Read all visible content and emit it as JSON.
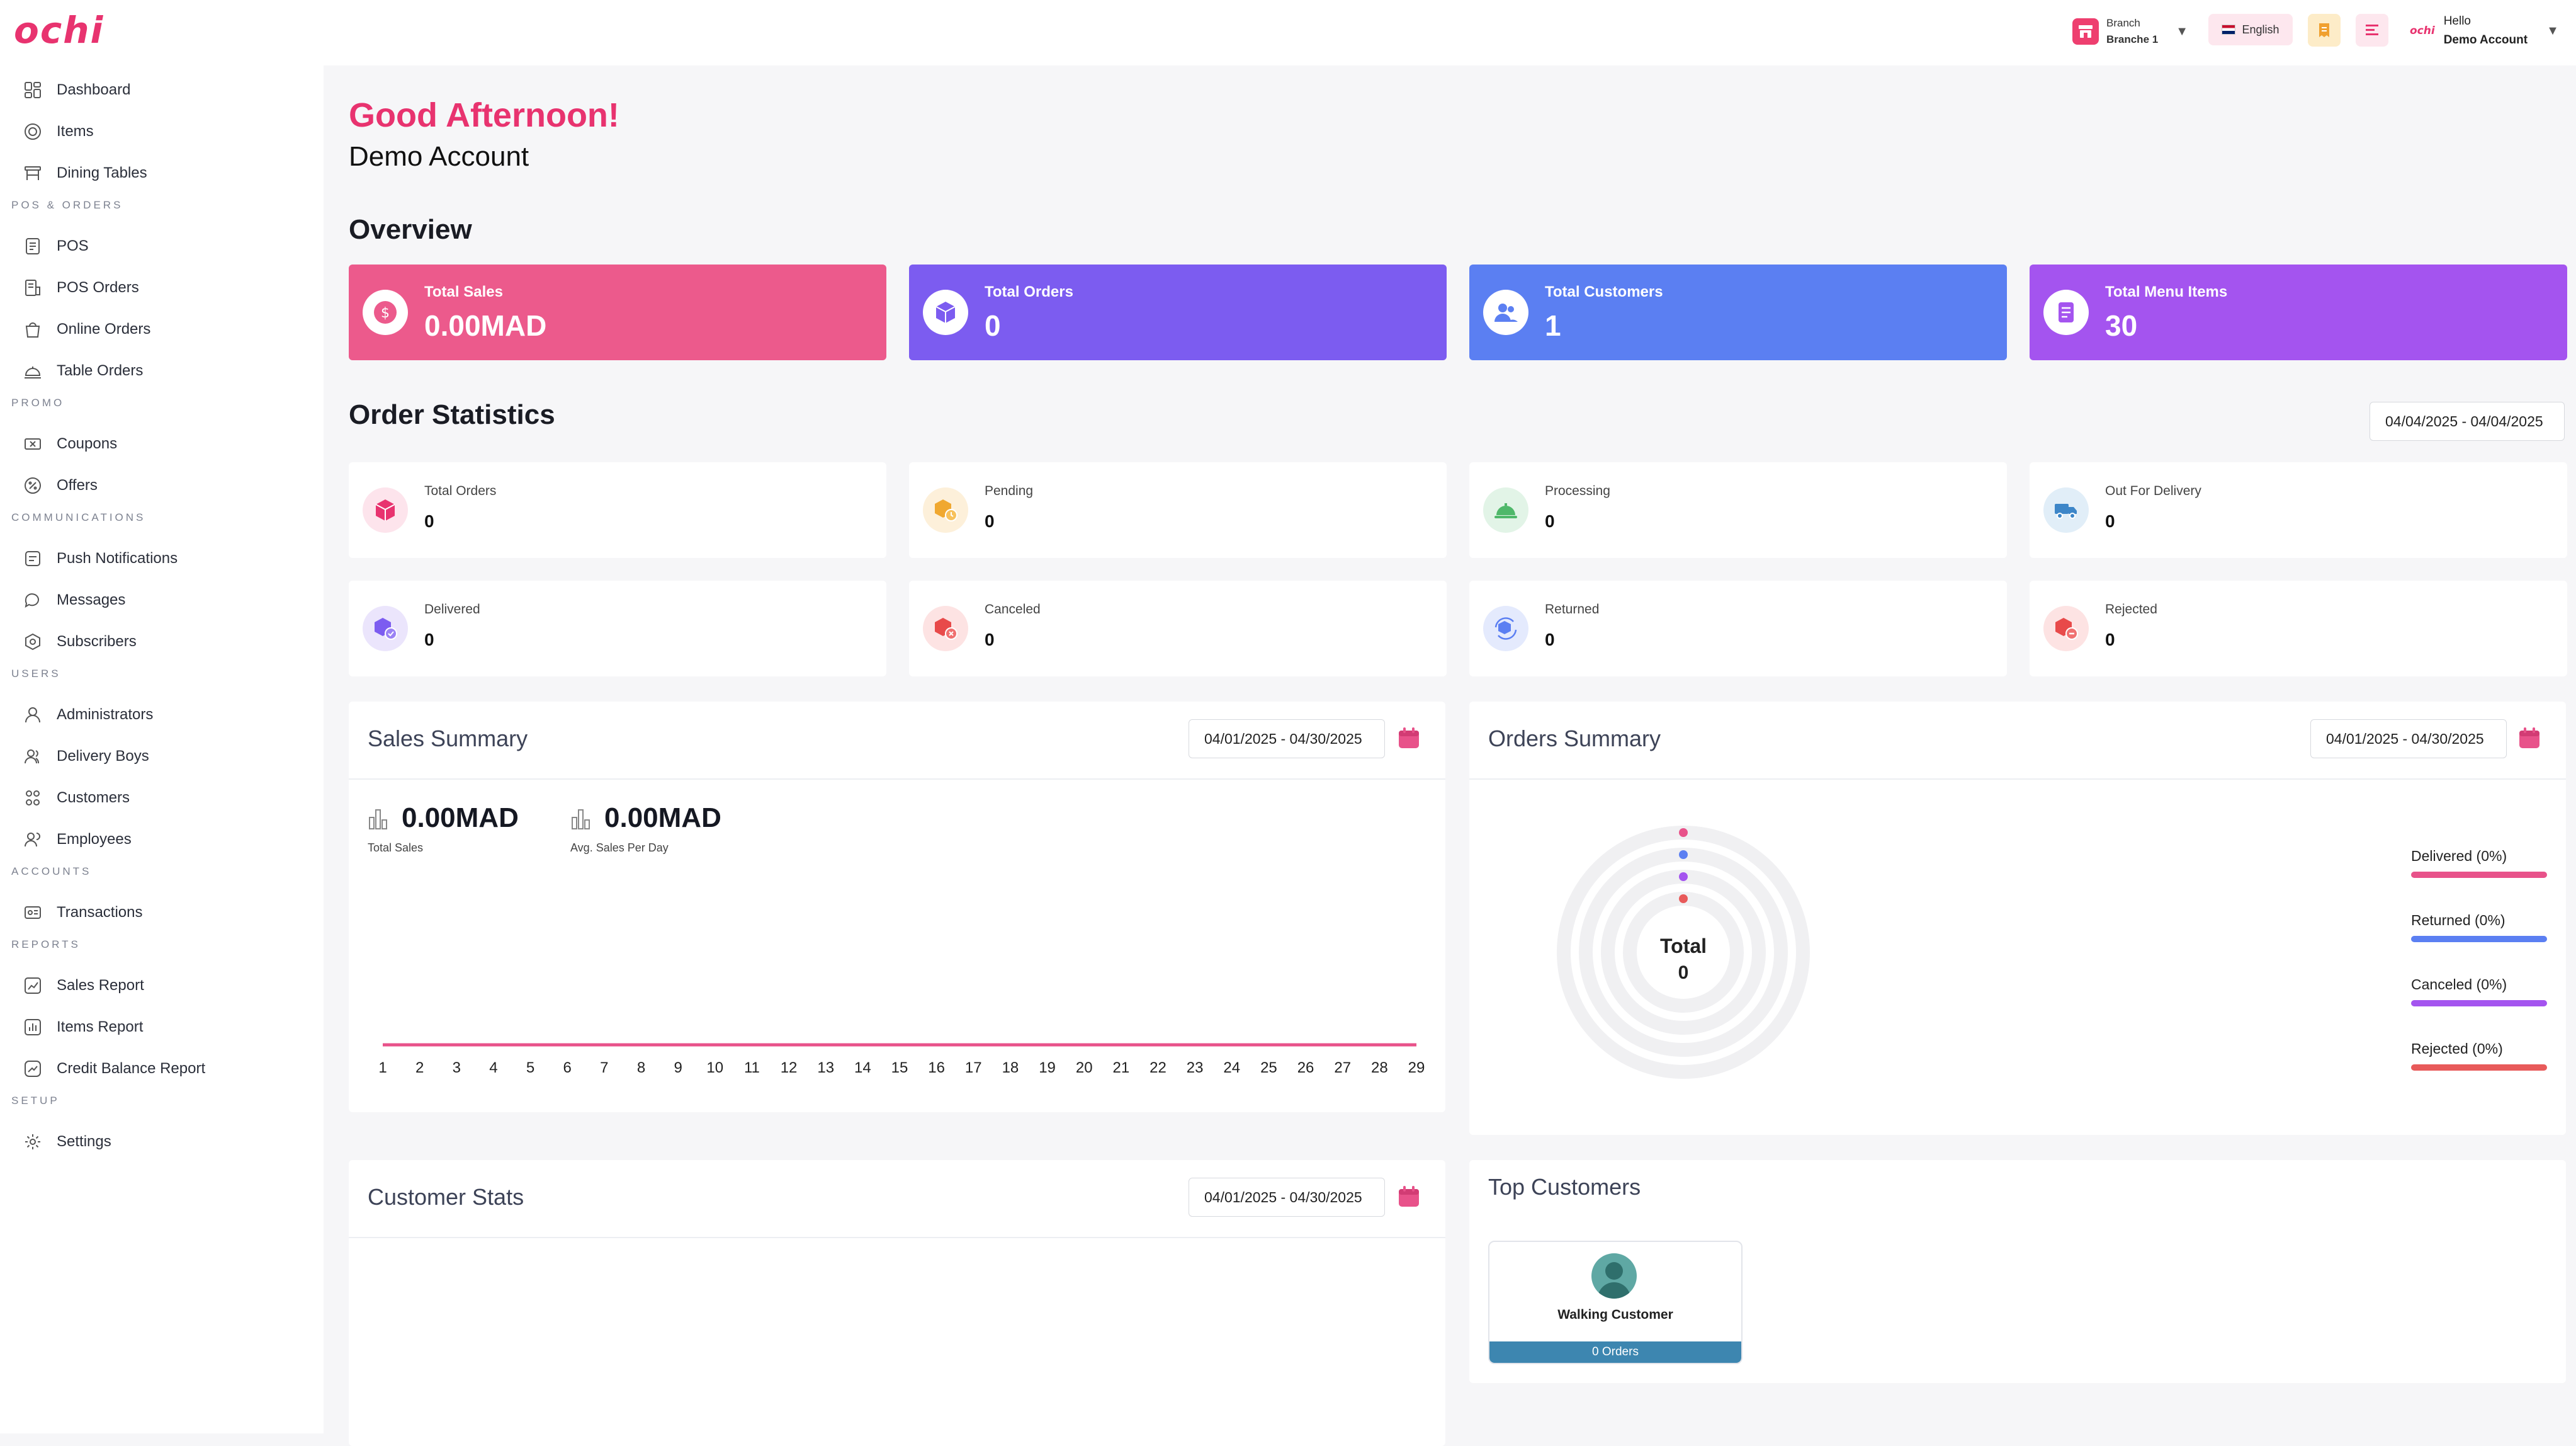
{
  "app": {
    "logo": "ochi"
  },
  "topbar": {
    "branch_label": "Branch",
    "branch_name": "Branche 1",
    "language": "English",
    "user_greeting": "Hello",
    "user_name": "Demo Account",
    "user_avatar_text": "ochi"
  },
  "sidebar": {
    "items": [
      {
        "label": "Dashboard",
        "icon": "dashboard-icon"
      },
      {
        "label": "Items",
        "icon": "items-icon"
      },
      {
        "label": "Dining Tables",
        "icon": "dining-table-icon"
      },
      {
        "label": "POS",
        "icon": "pos-icon"
      },
      {
        "label": "POS Orders",
        "icon": "pos-orders-icon"
      },
      {
        "label": "Online Orders",
        "icon": "bag-icon"
      },
      {
        "label": "Table Orders",
        "icon": "table-orders-icon"
      },
      {
        "label": "Coupons",
        "icon": "coupon-icon"
      },
      {
        "label": "Offers",
        "icon": "offer-icon"
      },
      {
        "label": "Push Notifications",
        "icon": "push-notification-icon"
      },
      {
        "label": "Messages",
        "icon": "message-icon"
      },
      {
        "label": "Subscribers",
        "icon": "subscriber-icon"
      },
      {
        "label": "Administrators",
        "icon": "admin-icon"
      },
      {
        "label": "Delivery Boys",
        "icon": "delivery-boy-icon"
      },
      {
        "label": "Customers",
        "icon": "customers-icon"
      },
      {
        "label": "Employees",
        "icon": "employees-icon"
      },
      {
        "label": "Transactions",
        "icon": "transaction-icon"
      },
      {
        "label": "Sales Report",
        "icon": "sales-report-icon"
      },
      {
        "label": "Items Report",
        "icon": "items-report-icon"
      },
      {
        "label": "Credit Balance Report",
        "icon": "credit-report-icon"
      },
      {
        "label": "Settings",
        "icon": "gear-icon"
      }
    ],
    "sections": [
      "POS & ORDERS",
      "PROMO",
      "COMMUNICATIONS",
      "USERS",
      "ACCOUNTS",
      "REPORTS",
      "SETUP"
    ]
  },
  "greeting": {
    "title": "Good Afternoon!",
    "name": "Demo Account"
  },
  "overview": {
    "title": "Overview",
    "cards": [
      {
        "label": "Total Sales",
        "value": "0.00MAD",
        "color": "#ec5a8c"
      },
      {
        "label": "Total Orders",
        "value": "0",
        "color": "#7c5cf0"
      },
      {
        "label": "Total Customers",
        "value": "1",
        "color": "#5b7ff2"
      },
      {
        "label": "Total Menu Items",
        "value": "30",
        "color": "#a454ef"
      }
    ]
  },
  "order_statistics": {
    "title": "Order Statistics",
    "date_range": "04/04/2025  -  04/04/2025",
    "cards": [
      {
        "label": "Total Orders",
        "value": "0",
        "icon": "box-icon",
        "color": "#e8336f"
      },
      {
        "label": "Pending",
        "value": "0",
        "icon": "pending-box-icon",
        "color": "#f0a830"
      },
      {
        "label": "Processing",
        "value": "0",
        "icon": "cloche-icon",
        "color": "#4fb86a"
      },
      {
        "label": "Out For Delivery",
        "value": "0",
        "icon": "delivery-truck-icon",
        "color": "#3d86c8"
      },
      {
        "label": "Delivered",
        "value": "0",
        "icon": "delivered-box-icon",
        "color": "#7c5cf0"
      },
      {
        "label": "Canceled",
        "value": "0",
        "icon": "canceled-box-icon",
        "color": "#e84a4a"
      },
      {
        "label": "Returned",
        "value": "0",
        "icon": "returned-box-icon",
        "color": "#5b7ff2"
      },
      {
        "label": "Rejected",
        "value": "0",
        "icon": "rejected-box-icon",
        "color": "#e84a4a"
      }
    ]
  },
  "sales_summary": {
    "title": "Sales Summary",
    "date_range": "04/01/2025  -  04/30/2025",
    "total_sales": "0.00MAD",
    "total_sales_label": "Total Sales",
    "avg_sales": "0.00MAD",
    "avg_sales_label": "Avg. Sales Per Day"
  },
  "orders_summary": {
    "title": "Orders Summary",
    "date_range": "04/01/2025  -  04/30/2025",
    "center_label": "Total",
    "center_value": "0",
    "legend": [
      {
        "label": "Delivered (0%)",
        "color": "#e8528a"
      },
      {
        "label": "Returned (0%)",
        "color": "#5b7ff2"
      },
      {
        "label": "Canceled (0%)",
        "color": "#a454ef"
      },
      {
        "label": "Rejected (0%)",
        "color": "#e85a5a"
      }
    ]
  },
  "customer_stats": {
    "title": "Customer Stats",
    "date_range": "04/01/2025  -  04/30/2025"
  },
  "top_customers": {
    "title": "Top Customers",
    "customers": [
      {
        "name": "Walking Customer",
        "orders": "0 Orders"
      }
    ]
  },
  "chart_data": {
    "type": "line",
    "title": "",
    "x": [
      1,
      2,
      3,
      4,
      5,
      6,
      7,
      8,
      9,
      10,
      11,
      12,
      13,
      14,
      15,
      16,
      17,
      18,
      19,
      20,
      21,
      22,
      23,
      24,
      25,
      26,
      27,
      28,
      29
    ],
    "series": [
      {
        "values": [
          0,
          0,
          0,
          0,
          0,
          0,
          0,
          0,
          0,
          0,
          0,
          0,
          0,
          0,
          0,
          0,
          0,
          0,
          0,
          0,
          0,
          0,
          0,
          0,
          0,
          0,
          0,
          0,
          0
        ],
        "color": "#e8528a"
      }
    ],
    "xlabel": "",
    "ylabel": "",
    "grid": false
  }
}
